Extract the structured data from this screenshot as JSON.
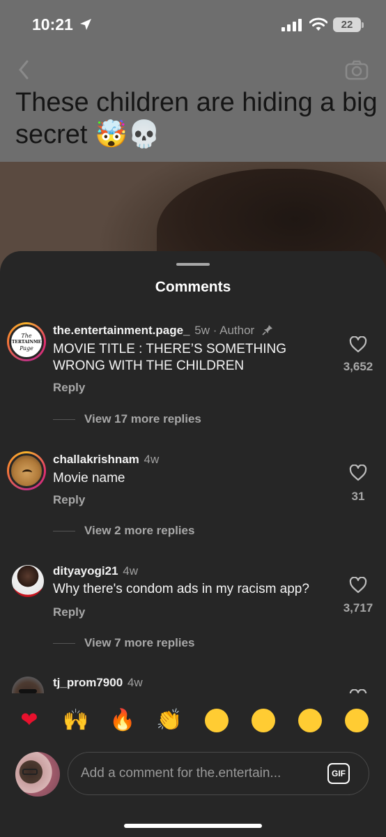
{
  "status_bar": {
    "time": "10:21",
    "battery": "22"
  },
  "post": {
    "title": "These children are hiding a big secret 🤯💀"
  },
  "sheet": {
    "title": "Comments"
  },
  "comments": [
    {
      "username": "the.entertainment.page_",
      "meta": "5w · Author",
      "pinned": true,
      "text": "MOVIE TITLE : THERE’S SOMETHING WRONG WITH THE CHILDREN",
      "reply_label": "Reply",
      "view_replies": "View 17 more replies",
      "likes": "3,652",
      "avatar_text": [
        "The",
        "ENTERTAINMENT",
        "Page"
      ]
    },
    {
      "username": "challakrishnam",
      "meta": "4w",
      "text": "Movie name",
      "reply_label": "Reply",
      "view_replies": "View 2 more replies",
      "likes": "31"
    },
    {
      "username": "dityayogi21",
      "meta": "4w",
      "text": "Why there's condom ads in my racism app?",
      "reply_label": "Reply",
      "view_replies": "View 7 more replies",
      "likes": "3,717"
    },
    {
      "username": "tj_prom7900",
      "meta": "4w"
    }
  ],
  "emoji_bar": [
    "❤",
    "🙌",
    "🔥",
    "👏",
    "😢",
    "😍",
    "😮",
    "😂"
  ],
  "composer": {
    "placeholder": "Add a comment for the.entertain...",
    "gif_label": "GIF"
  },
  "colors": {
    "sheet_bg": "#262626",
    "like_heart": "#e8112d"
  },
  "icons": [
    "back-chevron-icon",
    "camera-icon",
    "location-arrow-icon",
    "signal-icon",
    "wifi-icon",
    "pin-icon",
    "heart-icon",
    "gif-icon"
  ]
}
